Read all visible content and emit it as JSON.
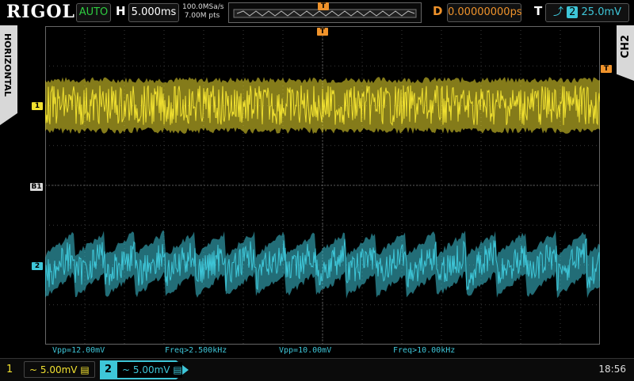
{
  "header": {
    "brand": "RIGOL",
    "run_mode": "AUTO",
    "horizontal_label": "H",
    "timebase": "5.000ms",
    "sample_rate": "100.0MSa/s",
    "memory_depth": "7.00M pts",
    "delay_label": "D",
    "delay": "0.00000000ps",
    "trigger_label": "T",
    "trigger_source": "2",
    "trigger_level": "25.0mV"
  },
  "side_tabs": {
    "left": "HORIZONTAL",
    "right": "CH2"
  },
  "markers": {
    "trigger_pos": "T",
    "trigger_level": "T",
    "ch1": "1",
    "ch2": "2",
    "ref": "B1"
  },
  "measurements": [
    {
      "label": "Vpp=12.00mV"
    },
    {
      "label": "Freq>2.500kHz"
    },
    {
      "label": "Vpp=10.00mV"
    },
    {
      "label": "Freq>10.00kHz"
    }
  ],
  "footer": {
    "ch1_num": "1",
    "ch1_scale": "~ 5.00mV",
    "ch2_num": "2",
    "ch2_scale": "~ 5.00mV",
    "time": "18:56"
  },
  "colors": {
    "ch1": "#f0e030",
    "ch2": "#3ec6d8",
    "delay": "#f0932b",
    "marker_orange": "#f0932b"
  }
}
